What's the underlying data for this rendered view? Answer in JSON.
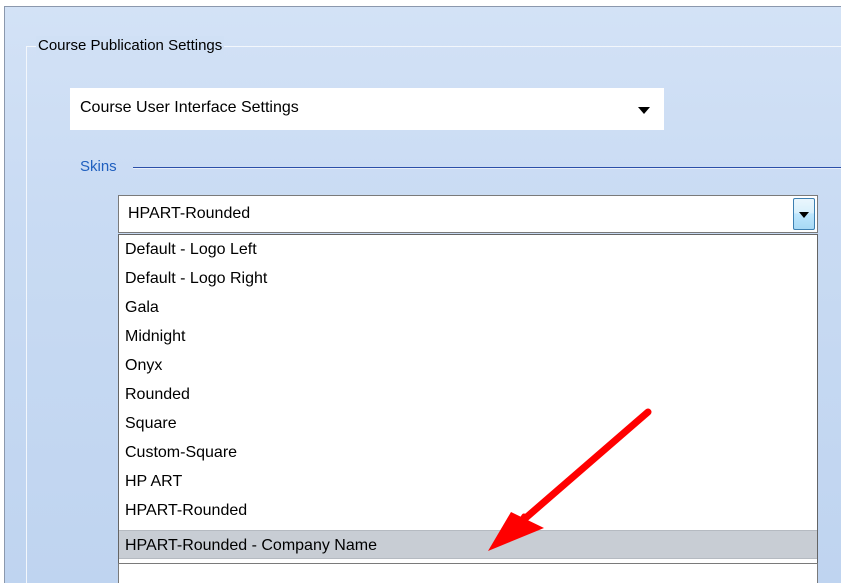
{
  "group": {
    "title": "Course Publication Settings"
  },
  "settings_select": {
    "value": "Course User Interface Settings"
  },
  "skins": {
    "label": "Skins",
    "selected_value": "HPART-Rounded",
    "options": [
      "Default - Logo Left",
      "Default - Logo Right",
      "Gala",
      "Midnight",
      "Onyx",
      "Rounded",
      "Square",
      "Custom-Square",
      "HP ART",
      "HPART-Rounded",
      "HPART-Rounded - Company Name"
    ],
    "highlighted_index": 10
  },
  "annotation": {
    "arrow_color": "#ff0000",
    "target": "HPART-Rounded - Company Name"
  },
  "colors": {
    "panel_bg": "#c9dbf3",
    "skins_label": "#1f5fbf",
    "highlight": "#c8cdd4"
  }
}
